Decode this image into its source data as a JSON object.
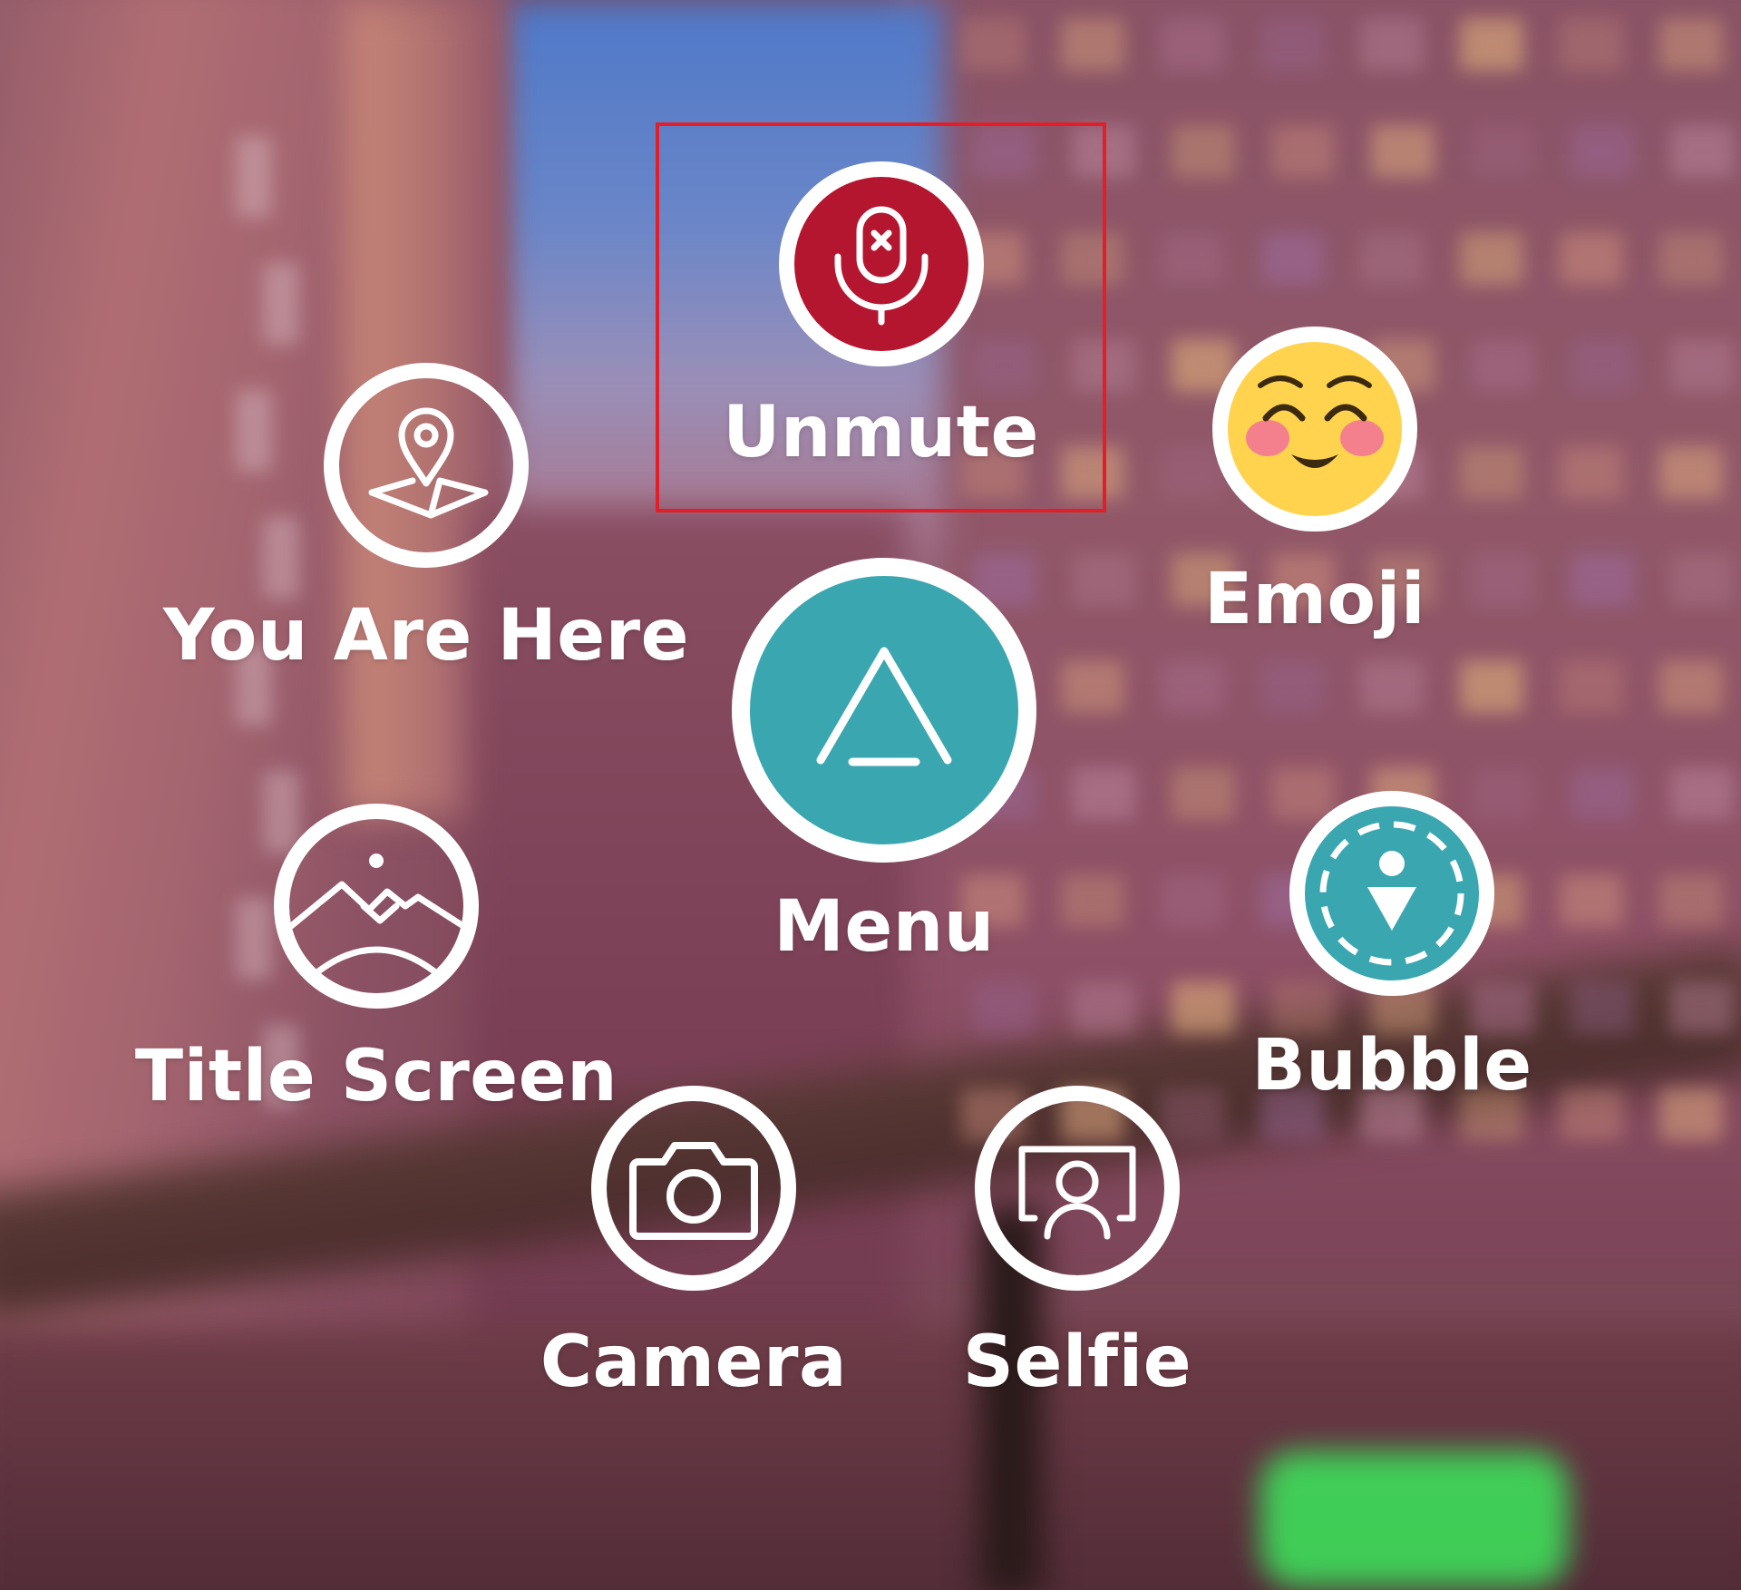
{
  "menu": {
    "items": [
      {
        "id": "unmute",
        "label": "Unmute",
        "icon": "microphone-muted-icon",
        "fill": "#b5162f",
        "selected": true
      },
      {
        "id": "you-are-here",
        "label": "You Are Here",
        "icon": "map-pin-icon",
        "fill": "transparent"
      },
      {
        "id": "emoji",
        "label": "Emoji",
        "icon": "smiling-face-emoji-icon",
        "fill": "#ffd34e"
      },
      {
        "id": "menu",
        "label": "Menu",
        "icon": "triangle-up-icon",
        "fill": "#3aa6b0"
      },
      {
        "id": "title-screen",
        "label": "Title Screen",
        "icon": "landscape-icon",
        "fill": "transparent"
      },
      {
        "id": "bubble",
        "label": "Bubble",
        "icon": "personal-bubble-icon",
        "fill": "#3aa6b0"
      },
      {
        "id": "camera",
        "label": "Camera",
        "icon": "camera-icon",
        "fill": "transparent"
      },
      {
        "id": "selfie",
        "label": "Selfie",
        "icon": "selfie-icon",
        "fill": "transparent"
      }
    ]
  },
  "colors": {
    "highlight": "#e01f2a",
    "ring": "#ffffff",
    "mute_red": "#b5162f",
    "teal": "#3aa6b0",
    "emoji_yellow": "#ffd34e"
  }
}
